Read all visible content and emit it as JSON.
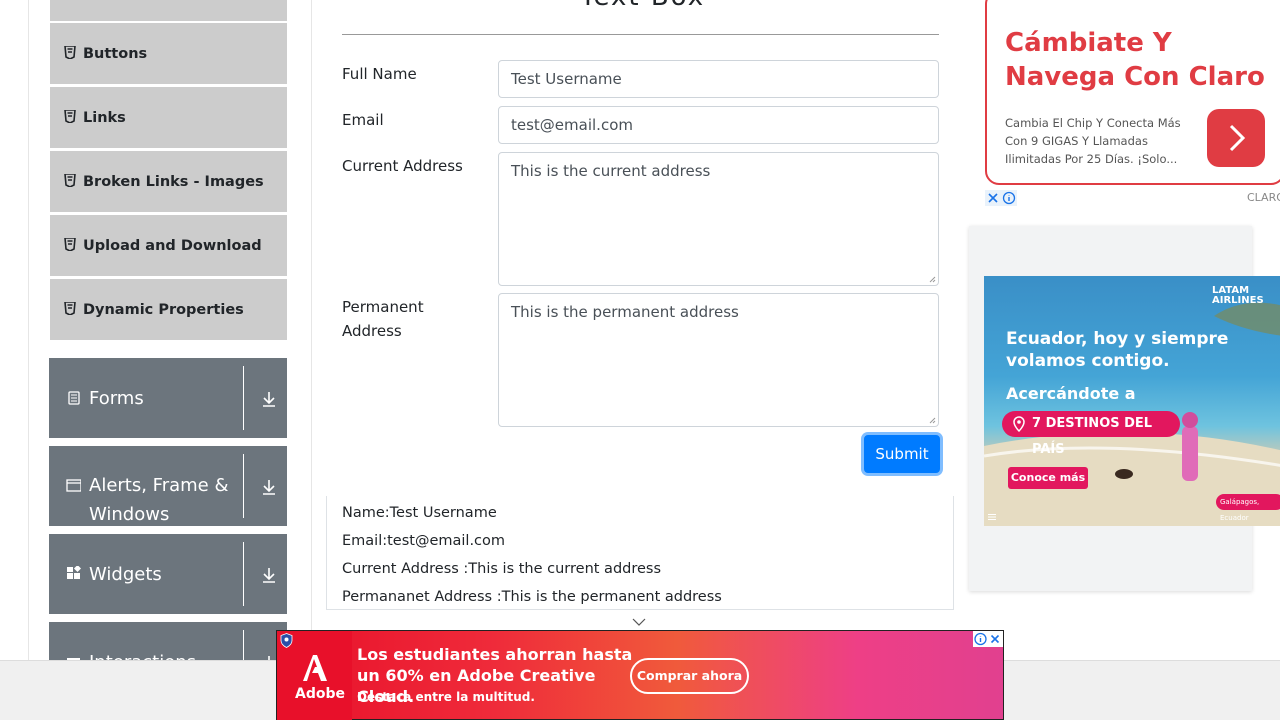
{
  "sidebar": {
    "elements_items": [
      {
        "label": "Buttons"
      },
      {
        "label": "Links"
      },
      {
        "label": "Broken Links - Images"
      },
      {
        "label": "Upload and Download"
      },
      {
        "label": "Dynamic Properties"
      }
    ],
    "groups": [
      {
        "label": "Forms",
        "icon": "form-icon"
      },
      {
        "label": "Alerts, Frame & Windows",
        "icon": "window-icon"
      },
      {
        "label": "Widgets",
        "icon": "widgets-icon"
      },
      {
        "label": "Interactions",
        "icon": "interactions-icon"
      }
    ]
  },
  "form": {
    "heading_fragment": "Text Box",
    "full_name": {
      "label": "Full Name",
      "value": "Test Username"
    },
    "email": {
      "label": "Email",
      "value": "test@email.com"
    },
    "current_address": {
      "label": "Current Address",
      "value": "This is the current address"
    },
    "permanent_address": {
      "label": "Permanent Address",
      "value": "This is the permanent address"
    },
    "submit_label": "Submit"
  },
  "output": {
    "name": "Name:Test Username",
    "email": "Email:test@email.com",
    "current_address": "Current Address :This is the current address",
    "permanent_address": "Permananet Address :This is the permanent address"
  },
  "ads": {
    "claro": {
      "headline": "Cámbiate Y Navega Con Claro",
      "body": "Cambia El Chip Y Conecta Más Con 9 GIGAS Y Llamadas Ilimitadas Por 25 Días. ¡Solo...",
      "advertiser": "CLARO",
      "accent": "#e03c43"
    },
    "latam": {
      "brand": "LATAM AIRLINES",
      "headline": "Ecuador, hoy y siempre volamos contigo.",
      "subhead": "Acercándote a",
      "pill": "7 DESTINOS DEL PAÍS",
      "cta": "Conoce más",
      "place": "Galápagos, Ecuador"
    },
    "adobe": {
      "line1": "Los estudiantes ahorran hasta un 60% en Adobe Creative Cloud.",
      "line2": "Destaca entre la multitud.",
      "cta": "Comprar ahora",
      "logo_text": "Adobe"
    }
  },
  "colors": {
    "sidebar_item_bg": "#cccccc",
    "group_bg": "#6c757d",
    "submit_bg": "#007bff"
  }
}
